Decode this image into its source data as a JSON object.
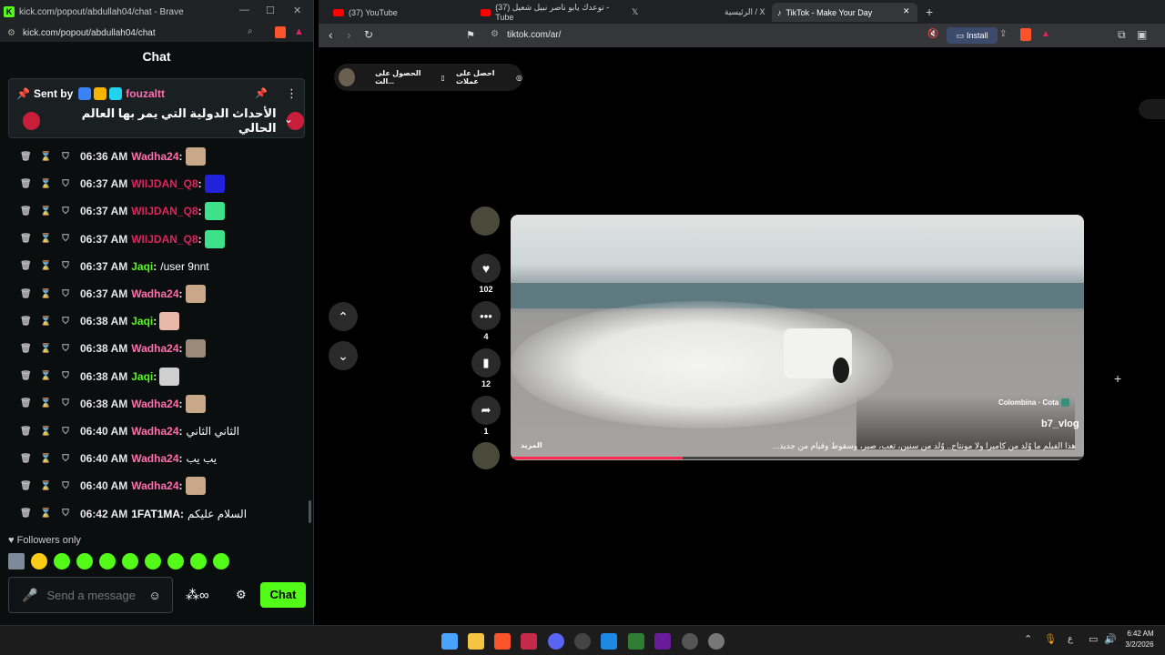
{
  "kick": {
    "window_title": "kick.com/popout/abdullah04/chat - Brave",
    "url": "kick.com/popout/abdullah04/chat",
    "chat_header": "Chat",
    "pinned": {
      "sent_by_label": "Sent by",
      "username": "fouzaltt",
      "message": "الأحداث الدولية التي يمر بها العالم الحالي"
    },
    "messages": [
      {
        "time": "06:36 AM",
        "user": "Wadha24",
        "text": "",
        "color": "#ff6fae"
      },
      {
        "time": "06:37 AM",
        "user": "WIIJDAN_Q8",
        "text": "",
        "color": "#e0245e"
      },
      {
        "time": "06:37 AM",
        "user": "WIIJDAN_Q8",
        "text": "",
        "color": "#e0245e"
      },
      {
        "time": "06:37 AM",
        "user": "WIIJDAN_Q8",
        "text": "",
        "color": "#e0245e"
      },
      {
        "time": "06:37 AM",
        "user": "Jaqi",
        "text": "/user 9nnt",
        "color": "#53fc18"
      },
      {
        "time": "06:37 AM",
        "user": "Wadha24",
        "text": "",
        "color": "#ff6fae"
      },
      {
        "time": "06:38 AM",
        "user": "Jaqi",
        "text": "",
        "color": "#53fc18"
      },
      {
        "time": "06:38 AM",
        "user": "Wadha24",
        "text": "",
        "color": "#ff6fae"
      },
      {
        "time": "06:38 AM",
        "user": "Jaqi",
        "text": "",
        "color": "#53fc18"
      },
      {
        "time": "06:38 AM",
        "user": "Wadha24",
        "text": "",
        "color": "#ff6fae"
      },
      {
        "time": "06:40 AM",
        "user": "Wadha24",
        "text": "الثاني الثاني",
        "color": "#ff6fae"
      },
      {
        "time": "06:40 AM",
        "user": "Wadha24",
        "text": "يب يب",
        "color": "#ff6fae"
      },
      {
        "time": "06:40 AM",
        "user": "Wadha24",
        "text": "",
        "color": "#ff6fae"
      },
      {
        "time": "06:42 AM",
        "user": "1FAT1MA",
        "text": "السلام عليكم",
        "color": "#ffffff"
      }
    ],
    "followers_only": "Followers only",
    "send_placeholder": "Send a message",
    "chat_button": "Chat"
  },
  "brave": {
    "tabs": [
      {
        "label": "(37) YouTube"
      },
      {
        "label": "(37) توعدك يابو ناصر نبيل شعيل - Tube"
      },
      {
        "label": ""
      },
      {
        "label": "الرئيسية / X"
      },
      {
        "label": "TikTok - Make Your Day"
      }
    ],
    "url": "tiktok.com/ar/",
    "install_label": "Install"
  },
  "tiktok": {
    "top_pill_1": "احصل على عملات",
    "top_pill_2": "الحصول على الت...",
    "likes": "102",
    "comments": "4",
    "saves": "12",
    "shares": "1",
    "location": "Colombina · Cota",
    "author": "b7_vlog",
    "caption": "هذا الفيلم ما وُلد من كاميرا ولا مونتاج.. وُلد من سنين، تعب، صبر، وسقوط وقيام من جديد...",
    "more_label": "المزيد",
    "progress": 0.3
  },
  "taskbar": {
    "time": "6:42 AM",
    "date": "3/2/2026",
    "lang": "ع"
  }
}
